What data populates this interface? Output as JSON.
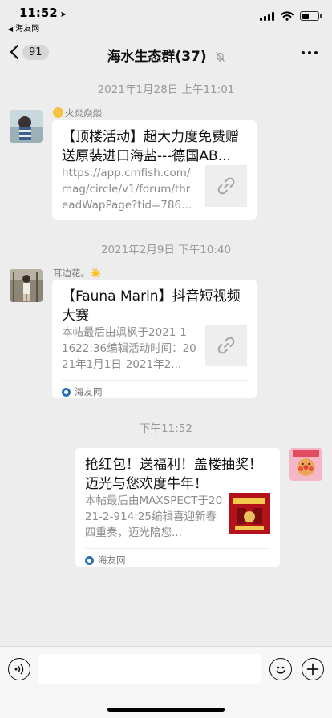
{
  "status_bar": {
    "time": "11:52",
    "back_app": "海友网"
  },
  "nav": {
    "back_count": "91",
    "title": "海水生态群(37)"
  },
  "messages": [
    {
      "timestamp": "2021年1月28日 上午11:01",
      "sender": "火炎焱燚",
      "card": {
        "title": "【顶楼活动】超大力度免费赠送原装进口海盐---德国AB...",
        "desc": "https://app.cmfish.com/mag/circle/v1/forum/threadWapPage?tid=786014&..."
      }
    },
    {
      "timestamp": "2021年2月9日 下午10:40",
      "sender": "耳边花。☀️",
      "card": {
        "title": "【Fauna Marin】抖音短视频大赛",
        "desc": "本帖最后由飒枫于2021-1-1622:36编辑活动时间：2021年1月1日-2021年2...",
        "source": "海友网"
      }
    },
    {
      "timestamp": "下午11:52",
      "card": {
        "title": "抢红包！送福利！盖楼抽奖！迈光与您欢度牛年！",
        "desc": "本帖最后由MAXSPECT于2021-2-914:25编辑喜迎新春四重奏，迈光陪您...",
        "source": "海友网"
      }
    }
  ],
  "colors": {
    "background": "#ededed",
    "card": "#ffffff",
    "timestamp": "#9a9a9a"
  },
  "icons": [
    "location-arrow-icon",
    "signal-icon",
    "wifi-icon",
    "battery-icon",
    "back-chevron-icon",
    "mute-bell-icon",
    "more-icon",
    "link-icon",
    "voice-icon",
    "emoji-icon",
    "plus-icon"
  ]
}
